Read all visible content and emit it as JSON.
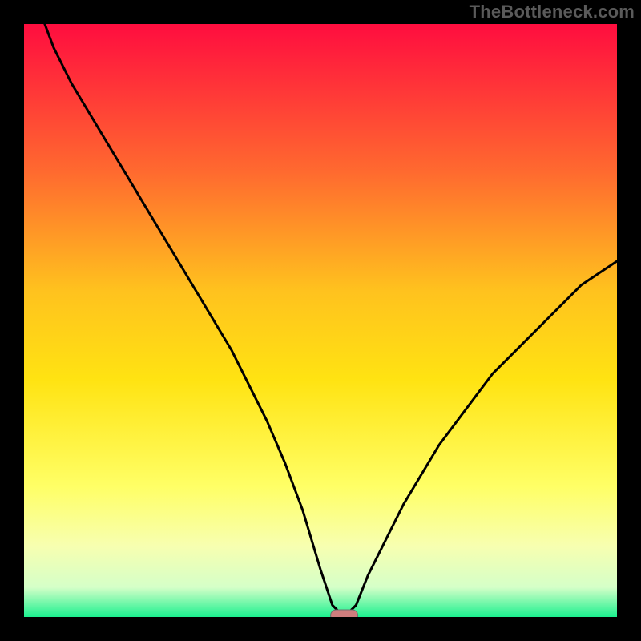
{
  "watermark": "TheBottleneck.com",
  "colors": {
    "frame": "#000000",
    "curve": "#000000",
    "marker_fill": "#cf7d7d",
    "marker_stroke": "#707070",
    "grad_top": "#ff0d3f",
    "grad_mid1": "#ff6a2f",
    "grad_mid2": "#ffc21e",
    "grad_mid3": "#ffe312",
    "grad_mid4": "#ffff66",
    "grad_mid5": "#f7ffb0",
    "grad_mid6": "#d5ffc8",
    "grad_bot": "#1cf18f"
  },
  "chart_data": {
    "type": "line",
    "title": "",
    "xlabel": "",
    "ylabel": "",
    "xlim": [
      0,
      100
    ],
    "ylim": [
      0,
      100
    ],
    "minimum_x": 54,
    "series": [
      {
        "name": "bottleneck-curve",
        "x": [
          0,
          2,
          5,
          8,
          11,
          14,
          17,
          20,
          23,
          26,
          29,
          32,
          35,
          38,
          41,
          44,
          47,
          50,
          52,
          54,
          56,
          58,
          61,
          64,
          67,
          70,
          73,
          76,
          79,
          82,
          85,
          88,
          91,
          94,
          97,
          100
        ],
        "values": [
          118,
          104,
          96,
          90,
          85,
          80,
          75,
          70,
          65,
          60,
          55,
          50,
          45,
          39,
          33,
          26,
          18,
          8,
          2,
          0,
          2,
          7,
          13,
          19,
          24,
          29,
          33,
          37,
          41,
          44,
          47,
          50,
          53,
          56,
          58,
          60
        ]
      }
    ],
    "marker": {
      "x": 54,
      "y": 0,
      "shape": "pill"
    },
    "baseline_y": 0
  }
}
